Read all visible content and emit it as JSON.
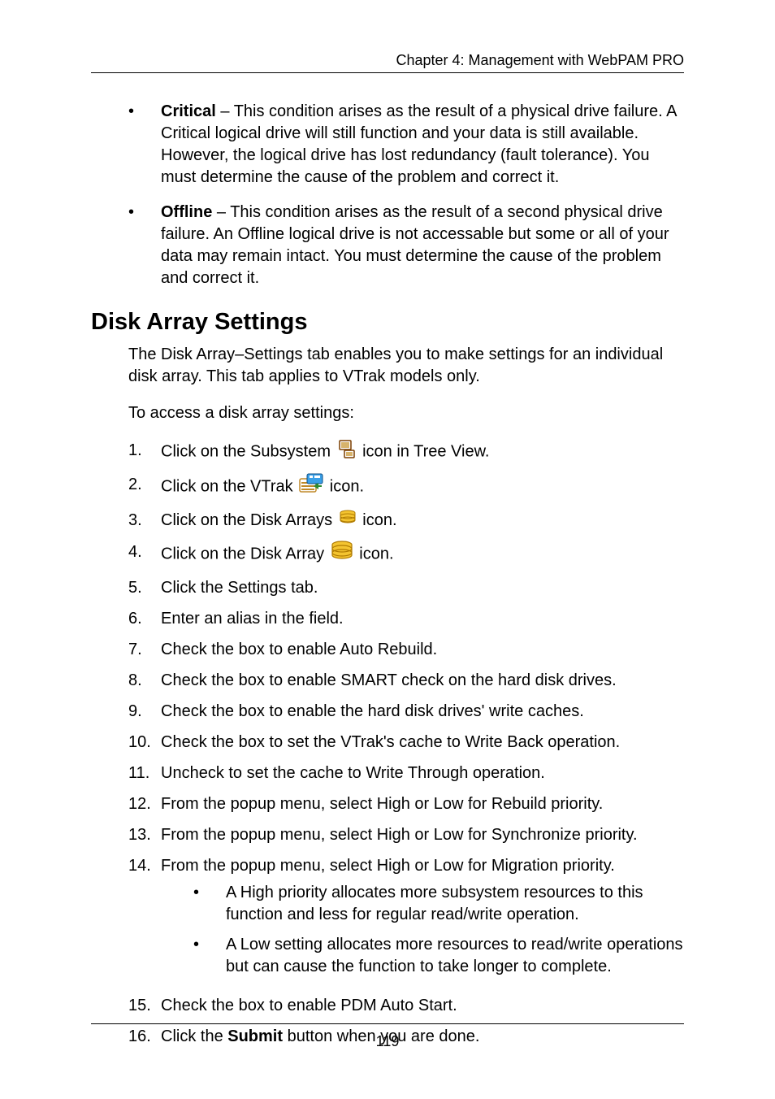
{
  "header": {
    "text": "Chapter 4: Management with WebPAM PRO"
  },
  "intro_bullets": [
    {
      "bold": "Critical",
      "rest": " – This condition arises as the result of a physical drive failure. A Critical logical drive will still function and your data is still available. However, the logical drive has lost redundancy (fault tolerance). You must determine the cause of the problem and correct it."
    },
    {
      "bold": "Offline",
      "rest": " – This condition arises as the result of a second physical drive failure. An Offline logical drive is not accessable but some or all of your data may remain intact. You must determine the cause of the problem and correct it."
    }
  ],
  "section": {
    "title": "Disk Array Settings",
    "para1": "The Disk Array–Settings tab enables you to make settings for an individual disk array. This tab applies to VTrak models only.",
    "para2": "To access a disk array settings:"
  },
  "steps": {
    "s1a": "Click on the Subsystem ",
    "s1b": " icon in Tree View.",
    "s2a": "Click on the VTrak ",
    "s2b": " icon.",
    "s3a": "Click on the Disk Arrays ",
    "s3b": " icon.",
    "s4a": "Click on the Disk Array ",
    "s4b": " icon.",
    "s5": "Click the Settings tab.",
    "s6": "Enter an alias in the field.",
    "s7": "Check the box to enable Auto Rebuild.",
    "s8": "Check the box to enable SMART check on the hard disk drives.",
    "s9": "Check the box to enable the hard disk drives' write caches.",
    "s10": "Check the box to set the VTrak's cache to Write Back operation.",
    "s11": "Uncheck to set the cache to Write Through operation.",
    "s12": "From the popup menu, select High or Low for Rebuild priority.",
    "s13": "From the popup menu, select High or Low for Synchronize priority.",
    "s14": "From the popup menu, select High or Low for Migration priority.",
    "s14_sub1": "A High priority allocates more subsystem resources to this function and less for regular read/write operation.",
    "s14_sub2": "A Low setting allocates more resources to read/write operations but can cause the function to take longer to complete.",
    "s15": "Check the box to enable PDM Auto Start.",
    "s16a": "Click the ",
    "s16b": "Submit",
    "s16c": " button when you are done."
  },
  "footer": {
    "page": "119"
  }
}
